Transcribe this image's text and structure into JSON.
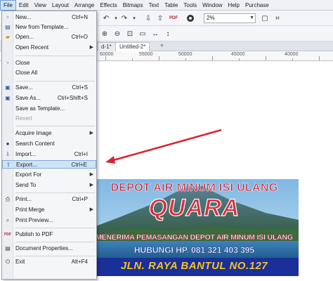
{
  "menubar": {
    "items": [
      "File",
      "Edit",
      "View",
      "Layout",
      "Arrange",
      "Effects",
      "Bitmaps",
      "Text",
      "Table",
      "Tools",
      "Window",
      "Help",
      "Purchase"
    ]
  },
  "toolbar": {
    "zoom_value": "2%"
  },
  "tabs": {
    "items": [
      "d-1*",
      "Untitled-2*"
    ],
    "add_symbol": "+"
  },
  "ruler": {
    "labels": [
      "60000",
      "55000",
      "50000",
      "45000",
      "40000"
    ]
  },
  "file_menu": {
    "new": {
      "label": "New...",
      "shortcut": "Ctrl+N"
    },
    "new_template": {
      "label": "New from Template..."
    },
    "open": {
      "label": "Open...",
      "shortcut": "Ctrl+O"
    },
    "open_recent": {
      "label": "Open Recent"
    },
    "close": {
      "label": "Close"
    },
    "close_all": {
      "label": "Close All"
    },
    "save": {
      "label": "Save...",
      "shortcut": "Ctrl+S"
    },
    "save_as": {
      "label": "Save As...",
      "shortcut": "Ctrl+Shift+S"
    },
    "save_template": {
      "label": "Save as Template..."
    },
    "revert": {
      "label": "Revert"
    },
    "acquire_image": {
      "label": "Acquire Image"
    },
    "search_content": {
      "label": "Search Content"
    },
    "import": {
      "label": "Import...",
      "shortcut": "Ctrl+I"
    },
    "export": {
      "label": "Export...",
      "shortcut": "Ctrl+E"
    },
    "export_for": {
      "label": "Export For"
    },
    "send_to": {
      "label": "Send To"
    },
    "print": {
      "label": "Print...",
      "shortcut": "Ctrl+P"
    },
    "print_merge": {
      "label": "Print Merge"
    },
    "print_preview": {
      "label": "Print Preview..."
    },
    "publish_pdf": {
      "label": "Publish to PDF"
    },
    "doc_properties": {
      "label": "Document Properties..."
    },
    "exit": {
      "label": "Exit",
      "shortcut": "Alt+F4"
    }
  },
  "banner": {
    "line1": "DEPOT AIR MINUM ISI ULANG",
    "line2": "QUARA",
    "line3": "MENERIMA PEMASANGAN DEPOT AIR MINUM ISI ULANG",
    "line4": "HUBUNGI HP. 081 321 403 395",
    "line5": "JLN. RAYA BANTUL NO.127"
  },
  "colors": {
    "arrow": "#d9232e",
    "menu_highlight": "#cfe3f7",
    "banner_strip": "#1b2f9a",
    "banner_title": "#d62f3f"
  }
}
